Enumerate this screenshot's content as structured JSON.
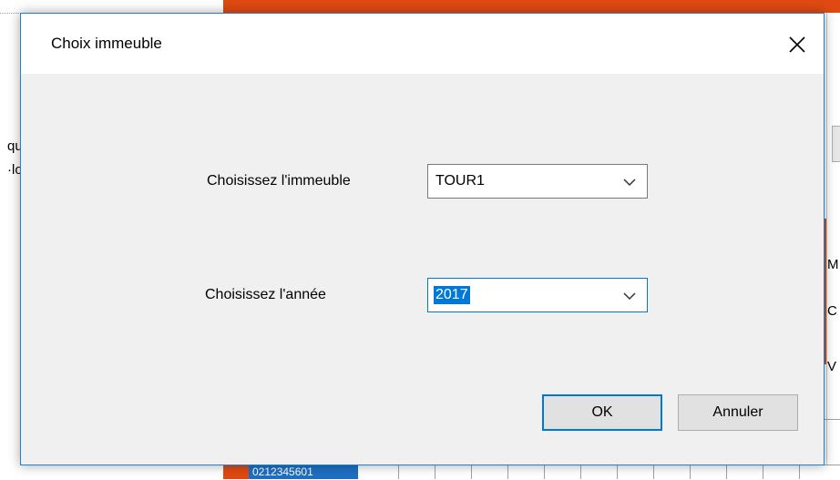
{
  "background": {
    "left_text_lines": [
      "que",
      "·lo"
    ],
    "right_letters": [
      "M",
      "C",
      "V"
    ],
    "selected_cell": "0212345601",
    "accent_color": "#e04a12"
  },
  "dialog": {
    "title": "Choix immeuble",
    "close_icon": "close-icon",
    "building_label": "Choisissez l'immeuble",
    "building_value": "TOUR1",
    "year_label": "Choisissez l'année",
    "year_value": "2017",
    "dropdown_icon": "chevron-down-icon",
    "ok_label": "OK",
    "cancel_label": "Annuler"
  }
}
